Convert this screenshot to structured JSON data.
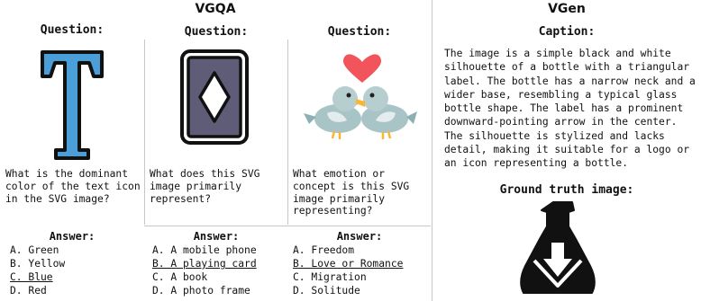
{
  "vgqa": {
    "title": "VGQA",
    "columns": [
      {
        "header": "Question:",
        "question": "What is the dominant color of the text icon in the SVG image?",
        "icon": "letter-t-icon",
        "answer_header": "Answer:",
        "options": [
          {
            "text": "A. Green",
            "correct": false
          },
          {
            "text": "B. Yellow",
            "correct": false
          },
          {
            "text": "C. Blue",
            "correct": true
          },
          {
            "text": "D. Red",
            "correct": false
          }
        ]
      },
      {
        "header": "Question:",
        "question": "What does this SVG image primarily represent?",
        "icon": "playing-card-icon",
        "answer_header": "Answer:",
        "options": [
          {
            "text": "A. A mobile phone",
            "correct": false
          },
          {
            "text": "B. A playing card",
            "correct": true
          },
          {
            "text": "C. A book",
            "correct": false
          },
          {
            "text": "D. A photo frame",
            "correct": false
          }
        ]
      },
      {
        "header": "Question:",
        "question": "What emotion or concept is this SVG image primarily representing?",
        "icon": "love-birds-icon",
        "answer_header": "Answer:",
        "options": [
          {
            "text": "A. Freedom",
            "correct": false
          },
          {
            "text": "B. Love or Romance",
            "correct": true
          },
          {
            "text": "C. Migration",
            "correct": false
          },
          {
            "text": "D. Solitude",
            "correct": false
          }
        ]
      }
    ]
  },
  "vgen": {
    "title": "VGen",
    "caption_header": "Caption:",
    "caption": "The image is a simple black and white silhouette of a bottle with a triangular label. The bottle has a narrow neck and a wider base, resembling a typical glass bottle shape. The label has a prominent downward-pointing arrow in the center. The silhouette is stylized and lacks detail, making it suitable for a logo or an icon representing a bottle.",
    "ground_truth_header": "Ground truth image:",
    "ground_truth_icon": "bottle-download-icon"
  },
  "colors": {
    "t_blue": "#4a9fd8",
    "card_gray": "#5e5c76",
    "heart_red": "#f2545b",
    "bird_teal": "#a9c4c6",
    "beak_yellow": "#f7b731",
    "divider": "#c8c8c8"
  }
}
